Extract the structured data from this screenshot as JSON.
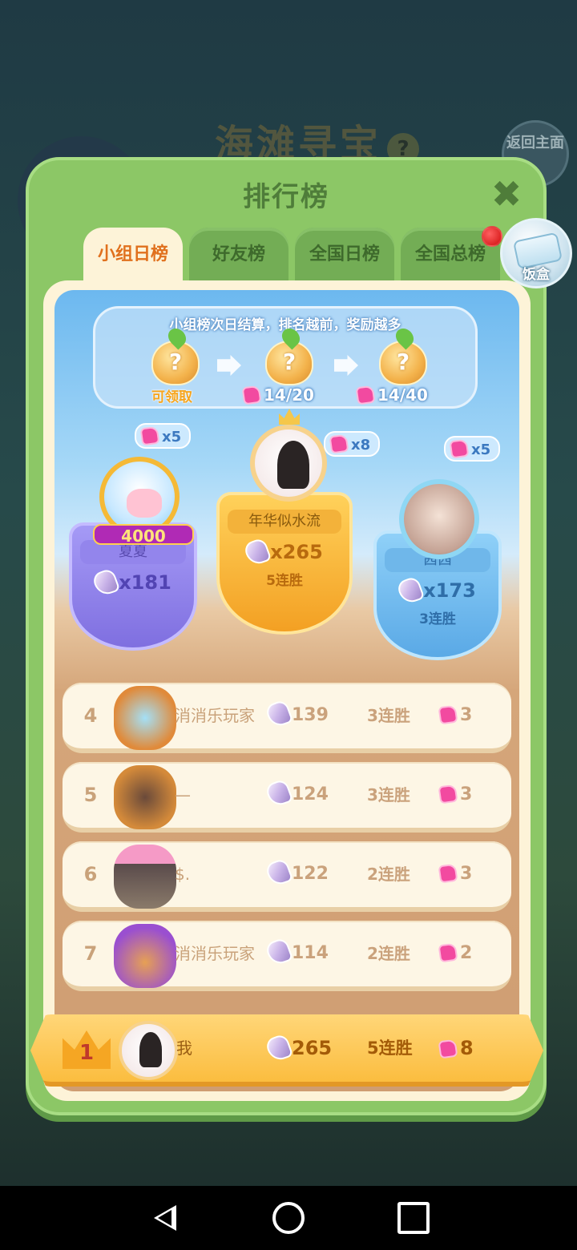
{
  "background": {
    "game_title": "海滩寻宝",
    "help_glyph": "?",
    "back_button": "返回主面"
  },
  "panel": {
    "title": "排行榜",
    "close_glyph": "✖"
  },
  "tabs": [
    {
      "label": "小组日榜",
      "active": true
    },
    {
      "label": "好友榜",
      "active": false
    },
    {
      "label": "全国日榜",
      "active": false
    },
    {
      "label": "全国总榜",
      "active": false
    }
  ],
  "box_icon": {
    "label": "饭盒"
  },
  "rewards": {
    "tip": "小组榜次日结算，排名越前，奖励越多",
    "chests": [
      {
        "status": "可领取"
      },
      {
        "progress": "14/20"
      },
      {
        "progress": "14/40"
      }
    ]
  },
  "podium": [
    {
      "place": 2,
      "name": "夏夏",
      "score": "x181",
      "streak": "",
      "hearts": "x5",
      "badge": "4000"
    },
    {
      "place": 1,
      "name": "年华似水流",
      "score": "x265",
      "streak": "5连胜",
      "hearts": "x8"
    },
    {
      "place": 3,
      "name": "茜茜",
      "score": "x173",
      "streak": "3连胜",
      "hearts": "x5"
    }
  ],
  "ranking": [
    {
      "rank": "4",
      "name": "消消乐玩家",
      "score": "139",
      "streak": "3连胜",
      "hearts": "3"
    },
    {
      "rank": "5",
      "name": "—",
      "score": "124",
      "streak": "3连胜",
      "hearts": "3"
    },
    {
      "rank": "6",
      "name": "$.",
      "score": "122",
      "streak": "2连胜",
      "hearts": "3"
    },
    {
      "rank": "7",
      "name": "消消乐玩家",
      "score": "114",
      "streak": "2连胜",
      "hearts": "2"
    }
  ],
  "me": {
    "rank": "1",
    "name": "我",
    "score": "265",
    "streak": "5连胜",
    "hearts": "8"
  },
  "colors": {
    "panel_green": "#8cc766",
    "active_tab_text": "#e0701d",
    "gold": "#fbbd3f",
    "heart_pink": "#f24aa0"
  }
}
